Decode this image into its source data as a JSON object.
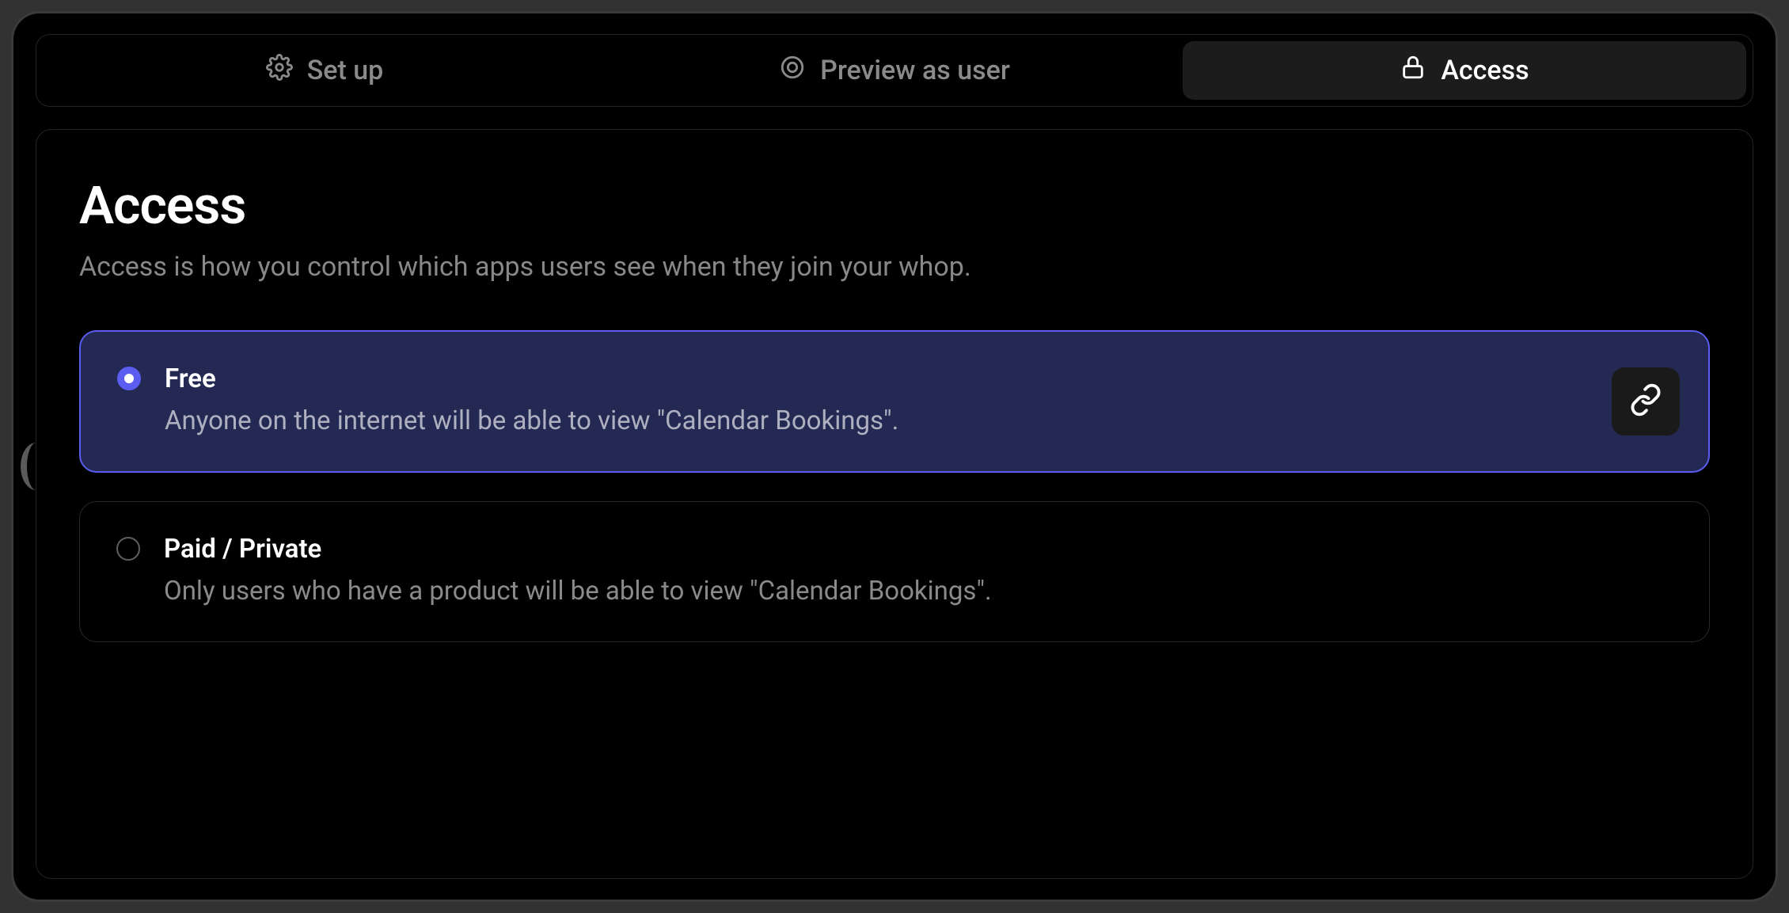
{
  "tabs": [
    {
      "label": "Set up",
      "icon": "gear-icon"
    },
    {
      "label": "Preview as user",
      "icon": "target-icon"
    },
    {
      "label": "Access",
      "icon": "lock-icon",
      "active": true
    }
  ],
  "page": {
    "title": "Access",
    "description": "Access is how you control which apps users see when they join your whop."
  },
  "options": [
    {
      "id": "free",
      "title": "Free",
      "description": "Anyone on the internet will be able to view \"Calendar Bookings\".",
      "selected": true,
      "has_link_button": true
    },
    {
      "id": "paid",
      "title": "Paid / Private",
      "description": "Only users who have a product will be able to view \"Calendar Bookings\".",
      "selected": false,
      "has_link_button": false
    }
  ]
}
